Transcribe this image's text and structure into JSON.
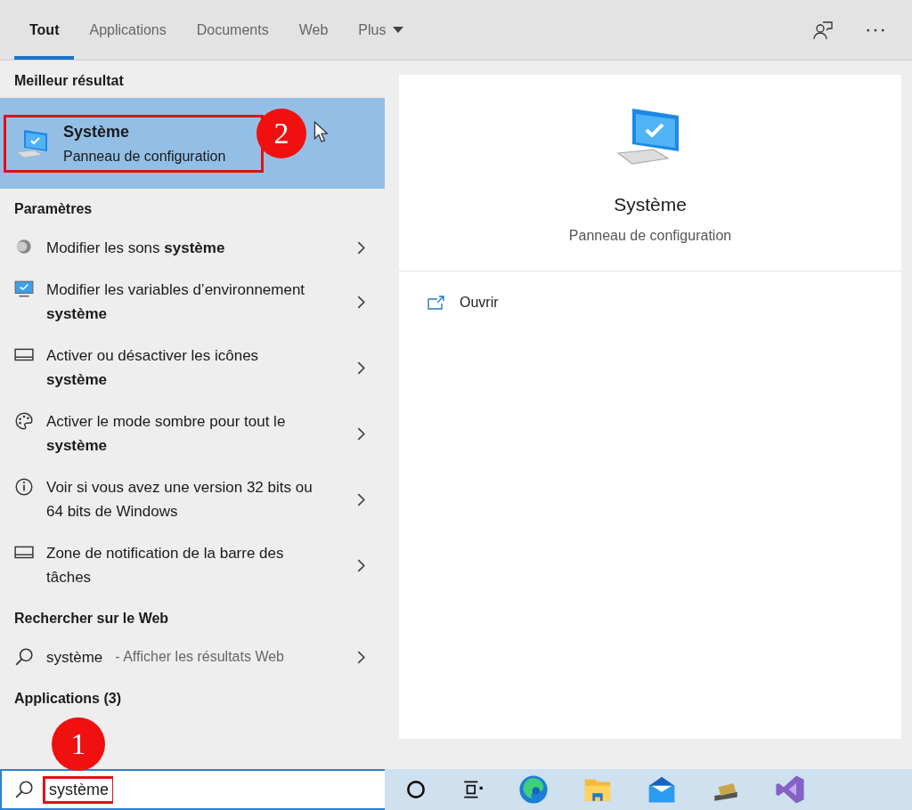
{
  "tabs": [
    {
      "label": "Tout",
      "selected": true,
      "dropdown": false
    },
    {
      "label": "Applications",
      "selected": false,
      "dropdown": false
    },
    {
      "label": "Documents",
      "selected": false,
      "dropdown": false
    },
    {
      "label": "Web",
      "selected": false,
      "dropdown": false
    },
    {
      "label": "Plus",
      "selected": false,
      "dropdown": true
    }
  ],
  "best_result": {
    "section": "Meilleur résultat",
    "title": "Système",
    "subtitle": "Panneau de configuration",
    "highlighted": true,
    "callout": "2"
  },
  "settings": {
    "section": "Paramètres",
    "items": [
      {
        "kind": "sound",
        "text": "Modifier les sons **système**"
      },
      {
        "kind": "monitor",
        "text": "Modifier les variables d’environnement **système**"
      },
      {
        "kind": "display",
        "text": "Activer ou désactiver les icônes **système**"
      },
      {
        "kind": "palette",
        "text": "Activer le mode sombre pour tout le **système**"
      },
      {
        "kind": "info",
        "text": "Voir si vous avez une version 32 bits ou 64 bits de Windows"
      },
      {
        "kind": "display",
        "text": "Zone de notification de la barre des tâches"
      }
    ]
  },
  "web": {
    "section": "Rechercher sur le Web",
    "query": "système",
    "hint": "- Afficher les résultats Web"
  },
  "apps": {
    "section": "Applications (3)"
  },
  "preview": {
    "title": "Système",
    "subtitle": "Panneau de configuration",
    "actions": [
      {
        "label": "Ouvrir"
      }
    ]
  },
  "search": {
    "value": "système",
    "highlighted": true,
    "callout": "1"
  },
  "taskbar": [
    {
      "kind": "cortana"
    },
    {
      "kind": "taskview"
    },
    {
      "kind": "edge"
    },
    {
      "kind": "folder"
    },
    {
      "kind": "mail"
    },
    {
      "kind": "tool"
    },
    {
      "kind": "vs"
    }
  ]
}
